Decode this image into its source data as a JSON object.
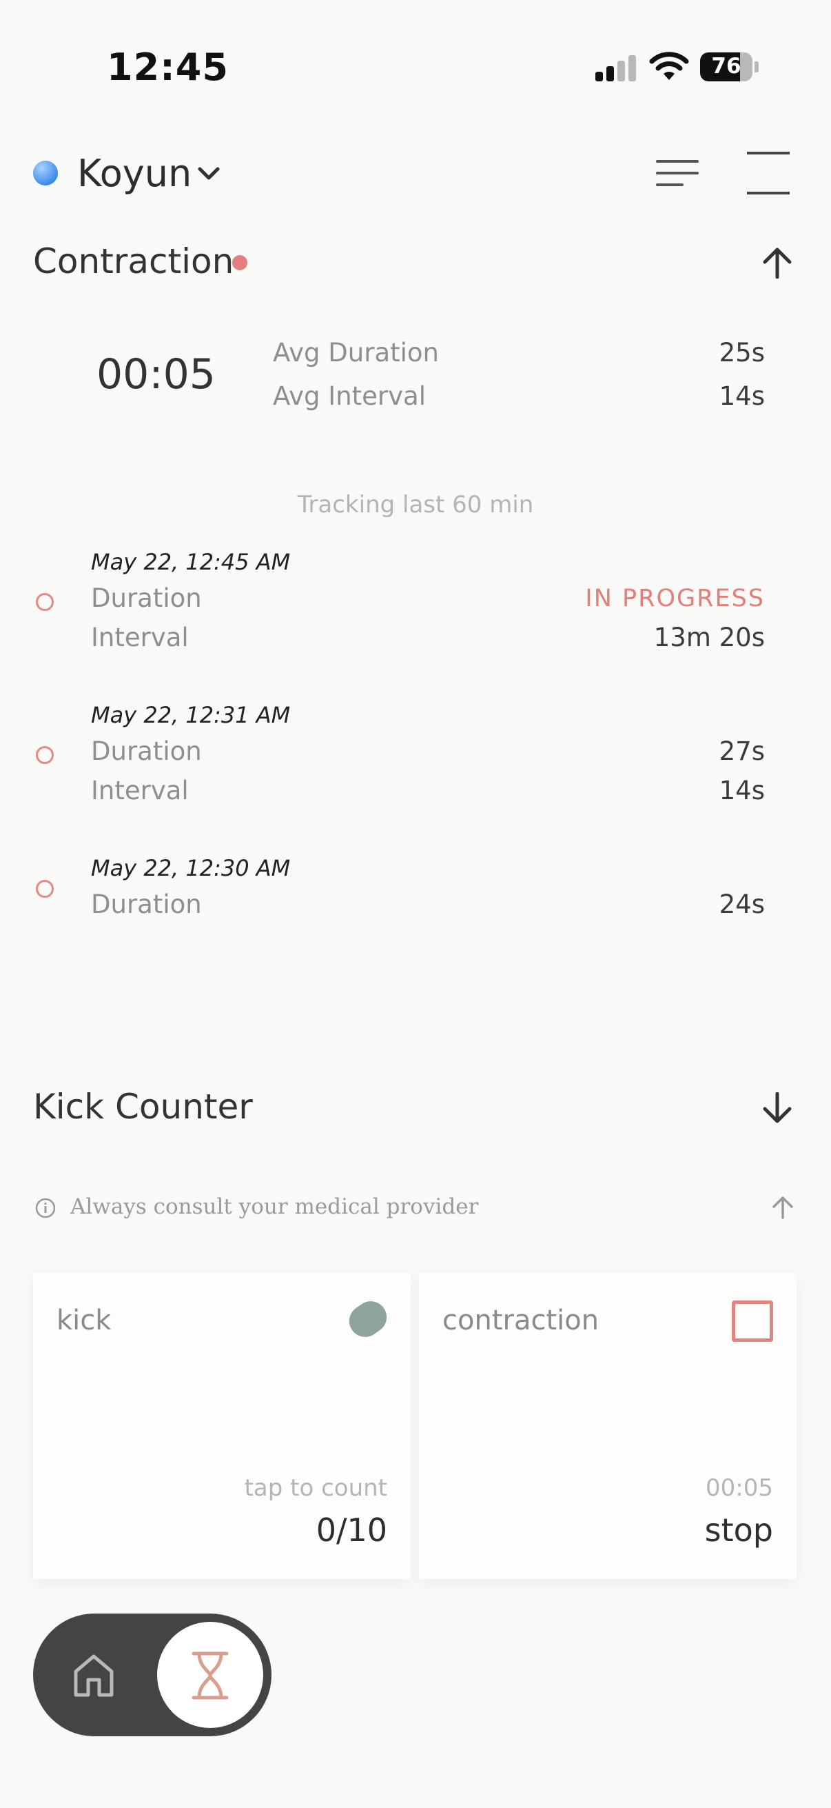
{
  "status_bar": {
    "time": "12:45",
    "battery": "76",
    "battery_level": 0.76
  },
  "header": {
    "profile_name": "Koyun",
    "profile_color": "#4a90e2"
  },
  "contraction": {
    "title": "Contraction",
    "timer": "00:05",
    "stats": [
      {
        "label": "Avg Duration",
        "value": "25s"
      },
      {
        "label": "Avg Interval",
        "value": "14s"
      }
    ],
    "tracking_note": "Tracking last 60 min",
    "entries": [
      {
        "date": "May 22, 12:45 AM",
        "duration_label": "Duration",
        "duration_value": "IN PROGRESS",
        "interval_label": "Interval",
        "interval_value": "13m 20s"
      },
      {
        "date": "May 22, 12:31 AM",
        "duration_label": "Duration",
        "duration_value": "27s",
        "interval_label": "Interval",
        "interval_value": "14s"
      },
      {
        "date": "May 22, 12:30 AM",
        "duration_label": "Duration",
        "duration_value": "24s"
      }
    ]
  },
  "kick_counter": {
    "title": "Kick Counter"
  },
  "notice": "Always consult your medical provider",
  "cards": {
    "kick": {
      "title": "kick",
      "hint": "tap to count",
      "value": "0/10"
    },
    "contraction": {
      "title": "contraction",
      "hint": "00:05",
      "value": "stop"
    }
  },
  "colors": {
    "accent": "#e07f7b",
    "kick": "#8fa49a",
    "tabbar": "#444444"
  },
  "tabs": [
    {
      "name": "home",
      "icon": "home-icon"
    },
    {
      "name": "timer",
      "icon": "hourglass-icon",
      "active": true
    }
  ]
}
